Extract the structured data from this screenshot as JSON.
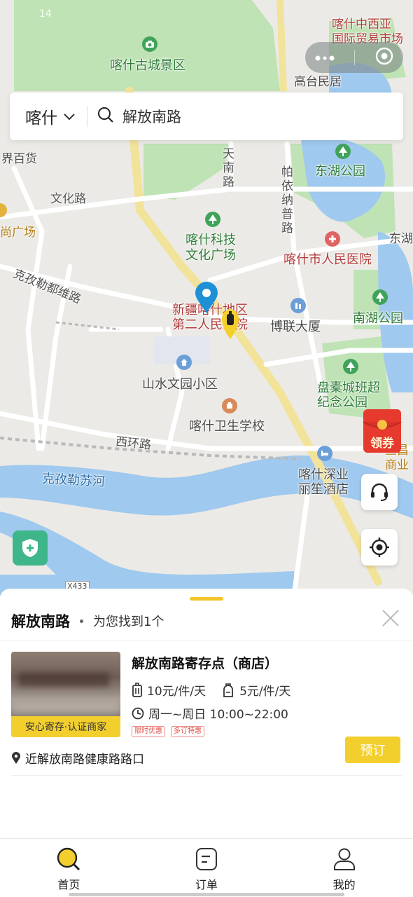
{
  "status_bar": {
    "time": "14"
  },
  "search": {
    "city": "喀什",
    "query": "解放南路"
  },
  "map": {
    "labels": {
      "kashgar_old_city": "喀什古城景区",
      "intl_market": "喀什中西亚\n国际贸易市场",
      "gaotai": "高台民居",
      "department_store": "界百货",
      "tiannan_road": "天南路",
      "payinapu_road": "帕依纳普路",
      "donghu_park": "东湖公园",
      "wenhua_road": "文化路",
      "square": "尚广场",
      "tech_square": "喀什科技\n文化广场",
      "people_hospital": "喀什市人民医院",
      "dongnan": "东湖",
      "kezilesu_road": "克孜勒都维路",
      "second_hospital": "新疆喀什地区\n第二人民医院",
      "bolian": "博联大厦",
      "nanhu_park": "南湖公园",
      "shanshui": "山水文园小区",
      "panqiao_park": "盘橐城班超\n纪念公园",
      "health_school": "喀什卫生学校",
      "xihuan_road": "西环路",
      "river": "克孜勒苏河",
      "hotel": "喀什深业\n丽笙酒店",
      "commerce": "旦昌\n商业",
      "road_code": "X433"
    }
  },
  "coupon": {
    "label": "领券"
  },
  "results": {
    "keyword": "解放南路",
    "found_text": "为您找到1个",
    "store": {
      "name": "解放南路寄存点（商店）",
      "badge": "安心寄存·认证商家",
      "price_large": "10元/件/天",
      "price_small": "5元/件/天",
      "hours": "周一~周日 10:00~22:00",
      "tags": [
        "限时优惠",
        "多订特惠"
      ],
      "address": "近解放南路健康路路口",
      "book_label": "预订"
    }
  },
  "tabs": [
    {
      "label": "首页",
      "icon": "search-icon",
      "active": true
    },
    {
      "label": "订单",
      "icon": "order-icon",
      "active": false
    },
    {
      "label": "我的",
      "icon": "user-icon",
      "active": false
    }
  ],
  "colors": {
    "accent": "#f3cf2e",
    "shield": "#3fb58a",
    "pin": "#1e90d6"
  }
}
